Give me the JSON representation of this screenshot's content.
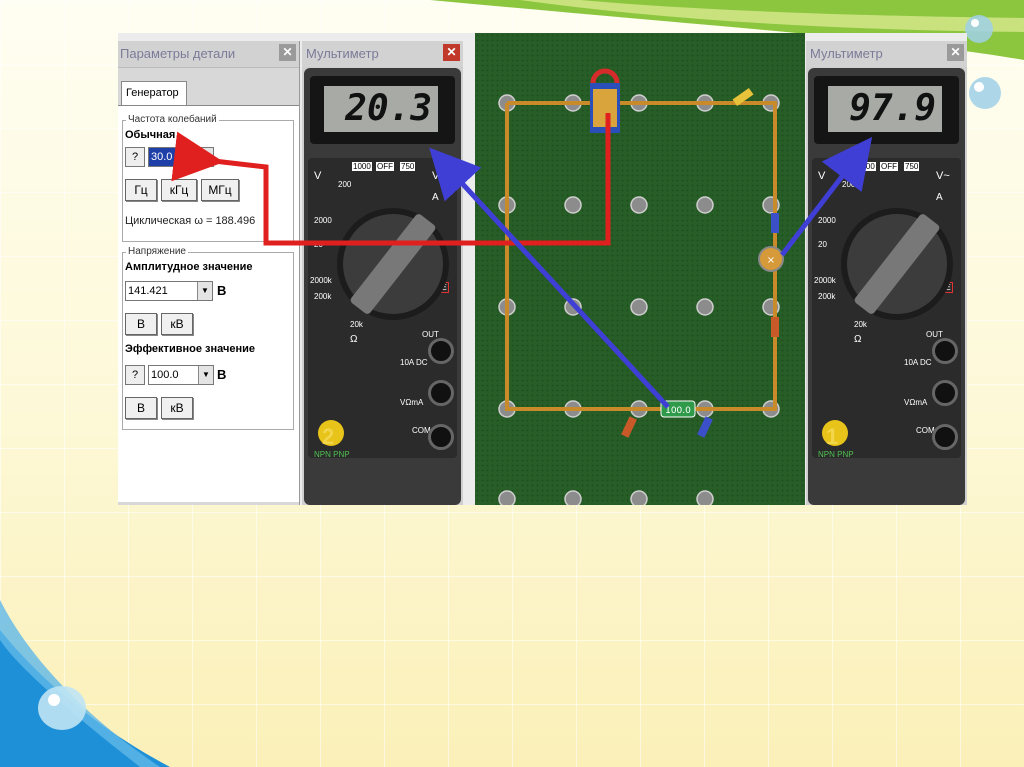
{
  "params_panel": {
    "title": "Параметры детали",
    "tab": "Генератор",
    "frequency_group": "Частота колебаний",
    "normal_label": "Обычная",
    "help": "?",
    "frequency_value": "30.0",
    "units": [
      "Гц",
      "кГц",
      "МГц"
    ],
    "cyclic_text": "Циклическая  ω = 188.496",
    "voltage_group": "Напряжение",
    "amplitude_label": "Амплитудное значение",
    "amplitude_value": "141.421",
    "amplitude_unit": "В",
    "amp_units": [
      "В",
      "кВ"
    ],
    "effective_label": "Эффективное значение",
    "effective_value": "100.0",
    "effective_unit": "В",
    "eff_units": [
      "В",
      "кВ"
    ]
  },
  "meter_left": {
    "title": "Мультиметр",
    "display": "20.3",
    "number": "2"
  },
  "meter_right": {
    "title": "Мультиметр",
    "display": "97.9",
    "number": "1"
  },
  "meter_labels": {
    "off": "OFF",
    "v_dc": "V",
    "v_ac": "V~",
    "a": "A",
    "r1000": "1000",
    "r750": "750",
    "r200": "200",
    "r20": "20",
    "r2000": "2000",
    "r20k": "20k",
    "r200k": "200k",
    "r2000k": "2000k",
    "hfe": "hFE",
    "ohm": "Ω",
    "npn_pnp": "NPN PNP",
    "out": "OUT",
    "com": "COM",
    "v_ohm": "VΩmA",
    "io_dc": "10A DC"
  },
  "board": {
    "resistor_value": "100.0"
  },
  "colors": {
    "arrow_red": "#e0201e",
    "arrow_blue": "#3f3fd6",
    "board_green": "#275e27"
  }
}
